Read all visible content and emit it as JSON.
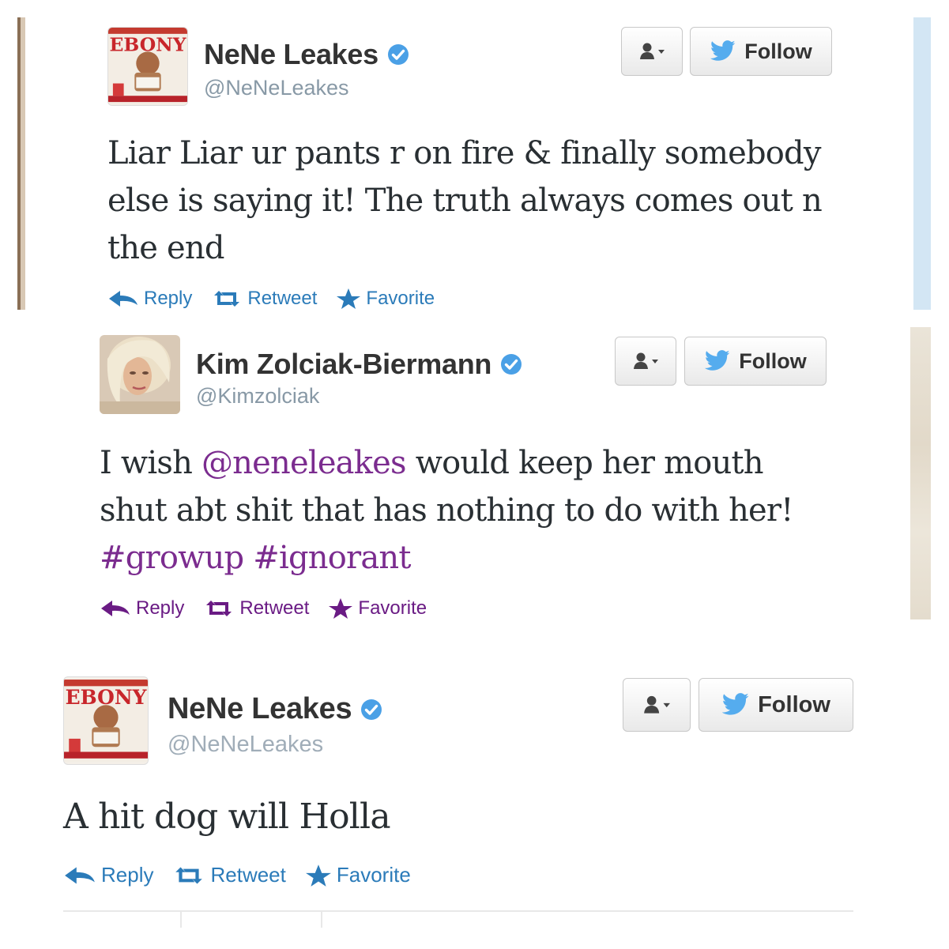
{
  "colors": {
    "link_blue": "#2b7bb9",
    "link_purple": "#6a1b84",
    "verified_blue": "#4aa0e6",
    "twitter_bird": "#55acee"
  },
  "tweets": [
    {
      "name": "NeNe Leakes",
      "handle": "@NeNeLeakes",
      "verified": true,
      "avatar": "ebony-magazine-cover",
      "avatar_text": "EBONY",
      "follow_label": "Follow",
      "text_parts": [
        "Liar Liar ur pants r on fire & finally somebody else is saying it! The truth always comes out n the end"
      ],
      "actions": {
        "reply": "Reply",
        "retweet": "Retweet",
        "favorite": "Favorite"
      }
    },
    {
      "name": "Kim Zolciak-Biermann",
      "handle": "@Kimzolciak",
      "verified": true,
      "avatar": "blonde-woman-photo",
      "follow_label": "Follow",
      "text_parts": {
        "prefix": "I wish ",
        "mention": "@neneleakes",
        "middle": " would keep her mouth shut abt shit that has nothing to do with her! ",
        "hashtag1": "#growup",
        "space": " ",
        "hashtag2": "#ignorant"
      },
      "actions": {
        "reply": "Reply",
        "retweet": "Retweet",
        "favorite": "Favorite"
      }
    },
    {
      "name": "NeNe Leakes",
      "handle": "@NeNeLeakes",
      "verified": true,
      "avatar": "ebony-magazine-cover",
      "avatar_text": "EBONY",
      "follow_label": "Follow",
      "text_parts": [
        "A hit dog will Holla"
      ],
      "actions": {
        "reply": "Reply",
        "retweet": "Retweet",
        "favorite": "Favorite"
      }
    }
  ]
}
